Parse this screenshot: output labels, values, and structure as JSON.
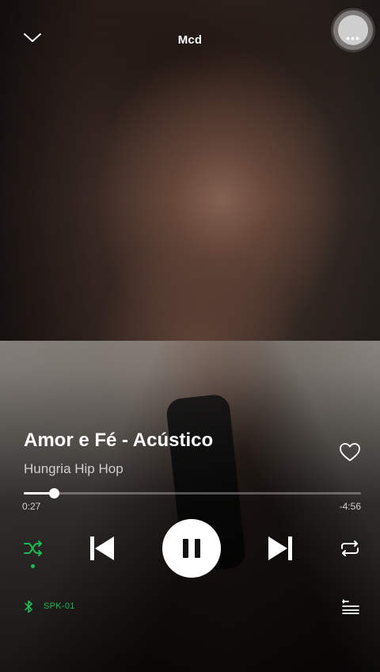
{
  "app": {
    "accent_color": "#1db954"
  },
  "header": {
    "playlist_title": "Mcd",
    "collapse_icon": "chevron-down-icon",
    "more_icon": "more-options-icon"
  },
  "track": {
    "title": "Amor e Fé - Acústico",
    "artist": "Hungria Hip Hop",
    "liked": false
  },
  "playback": {
    "elapsed": "0:27",
    "remaining": "-4:56",
    "progress_fraction": 0.09,
    "is_playing": true,
    "shuffle_on": true,
    "repeat_on": false
  },
  "controls": {
    "shuffle_icon": "shuffle-icon",
    "previous_icon": "skip-previous-icon",
    "pause_icon": "pause-icon",
    "next_icon": "skip-next-icon",
    "repeat_icon": "repeat-icon"
  },
  "footer": {
    "device_icon": "bluetooth-icon",
    "device_name": "SPK-01",
    "queue_icon": "queue-icon"
  }
}
